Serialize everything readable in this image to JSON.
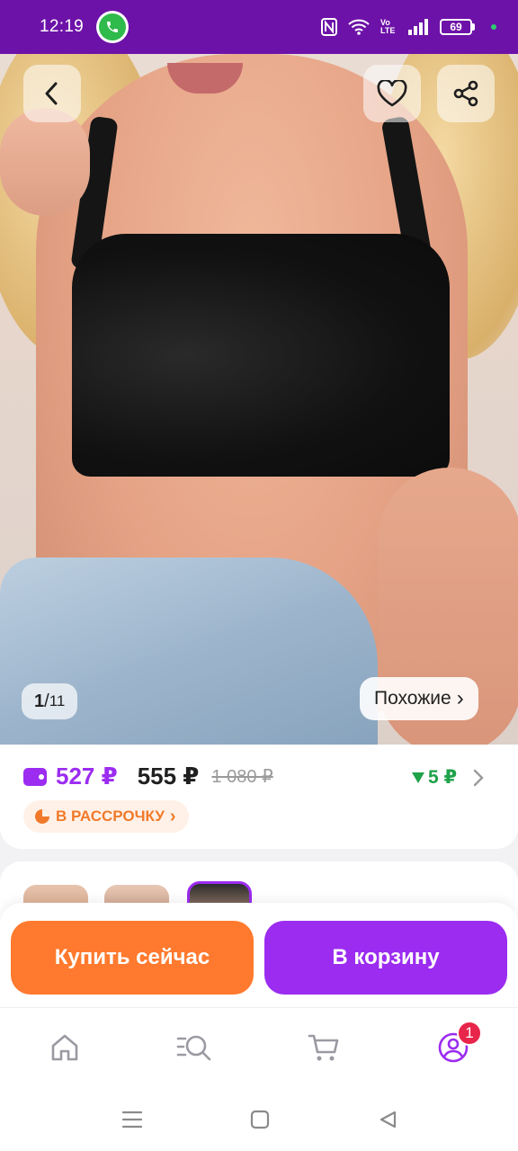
{
  "status_bar": {
    "time": "12:19",
    "network_label": "Vo LTE",
    "battery": "69"
  },
  "product_image": {
    "counter_current": "1",
    "counter_separator": "/",
    "counter_total": "11",
    "similar_label": "Похожие",
    "similar_chevron": "›"
  },
  "price": {
    "wallet_price": "527 ₽",
    "current_price": "555 ₽",
    "old_price": "1 080 ₽",
    "bonus": "5 ₽",
    "installment_label": "В РАССРОЧКУ",
    "installment_chevron": "›"
  },
  "actions": {
    "buy_now": "Купить сейчас",
    "add_to_cart": "В корзину"
  },
  "bottom_nav": {
    "profile_badge": "1"
  },
  "colors": {
    "brand_purple": "#9b2cf0",
    "status_purple": "#6d12a8",
    "buy_orange": "#ff7a2e",
    "bonus_green": "#1fa24a",
    "badge_red": "#e8254a"
  },
  "icons": [
    "back-arrow-icon",
    "heart-icon",
    "share-icon",
    "wallet-icon",
    "triangle-down-icon",
    "chevron-right-icon",
    "pie-icon",
    "home-icon",
    "catalog-search-icon",
    "cart-icon",
    "profile-icon",
    "phone-icon",
    "wifi-icon",
    "signal-icon",
    "nfc-icon"
  ]
}
